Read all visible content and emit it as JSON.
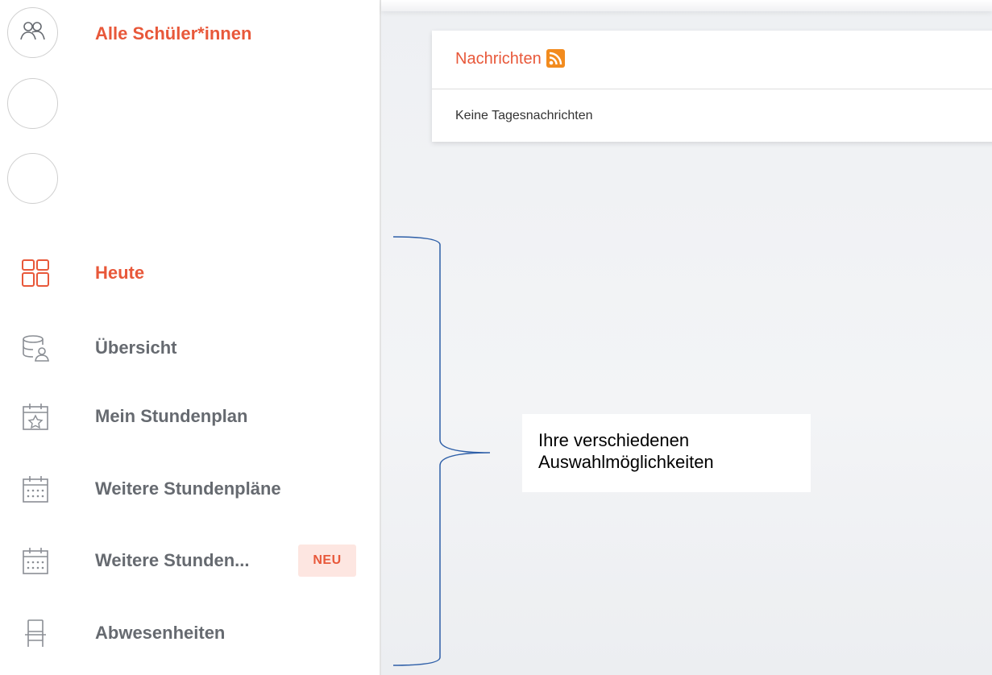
{
  "sidebar": {
    "all_students": {
      "label": "Alle Schüler*innen",
      "icon": "group-icon"
    },
    "nav": [
      {
        "label": "Heute",
        "icon": "dashboard-icon",
        "active": true
      },
      {
        "label": "Übersicht",
        "icon": "overview-icon"
      },
      {
        "label": "Mein Stundenplan",
        "icon": "calendar-star-icon"
      },
      {
        "label": "Weitere Stundenpläne",
        "icon": "calendar-grid-icon"
      },
      {
        "label": "Weitere Stunden...",
        "icon": "calendar-grid-icon",
        "badge": "NEU"
      },
      {
        "label": "Abwesenheiten",
        "icon": "chair-icon"
      }
    ]
  },
  "news": {
    "title": "Nachrichten",
    "empty_text": "Keine Tagesnachrichten"
  },
  "annotation": {
    "text": "Ihre verschiedenen Auswahlmöglichkeiten"
  },
  "colors": {
    "accent": "#e8583a",
    "nav_text": "#666a70",
    "rss": "#f28b1e",
    "brace": "#2e5fa8"
  }
}
